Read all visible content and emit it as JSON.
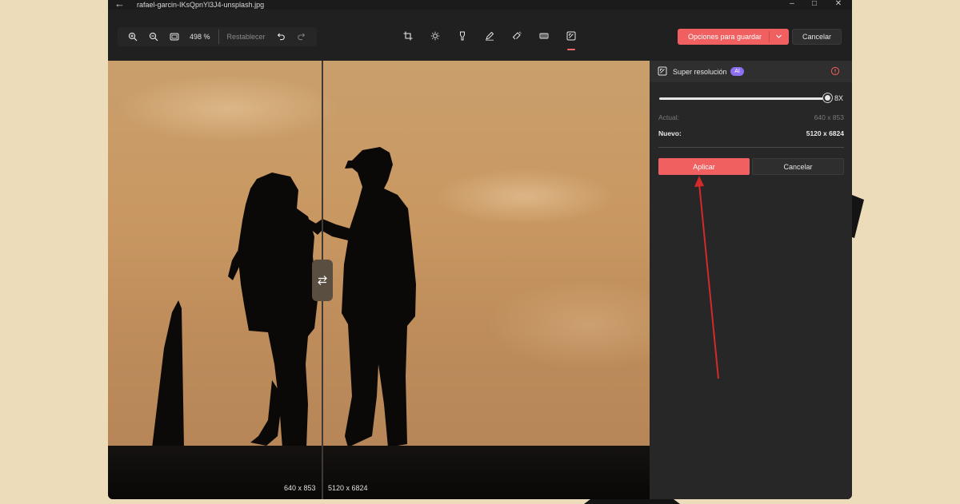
{
  "window": {
    "title": "rafael-garcin-IKsQpnYl3J4-unsplash.jpg",
    "back_icon": "back-arrow-icon",
    "controls": [
      "minimize-icon",
      "maximize-icon",
      "close-icon"
    ]
  },
  "toolbar": {
    "zoom_level": "498 %",
    "reset_label": "Restablecer",
    "left_icons": [
      "zoom-in-icon",
      "zoom-out-icon",
      "fit-screen-icon",
      "undo-icon",
      "redo-icon"
    ],
    "tools": [
      "crop-icon",
      "brightness-icon",
      "mark-icon",
      "draw-icon",
      "erase-icon",
      "filter-icon",
      "super-resolution-icon"
    ],
    "active_tool": "super-resolution-icon",
    "save_label": "Opciones para guardar",
    "cancel_label": "Cancelar"
  },
  "canvas": {
    "before_label": "640 x 853",
    "after_label": "5120 x 6824"
  },
  "panel": {
    "title": "Super resolución",
    "badge": "AI",
    "slider": {
      "value": "8X",
      "fraction": 1.0
    },
    "current_label": "Actual:",
    "current_value": "640 x 853",
    "new_label": "Nuevo:",
    "new_value": "5120 x 6824",
    "apply_label": "Aplicar",
    "cancel_label": "Cancelar"
  },
  "colors": {
    "accent": "#f06060",
    "ai_badge": "#8c6ff2",
    "annotation_arrow": "#d42a2a",
    "page_background": "#eddcb9"
  }
}
